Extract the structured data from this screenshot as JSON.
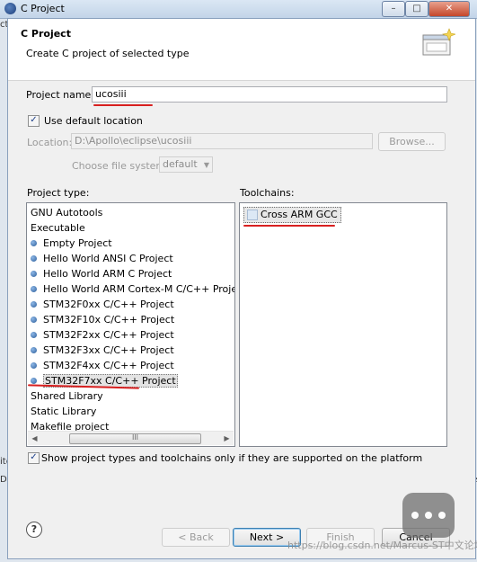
{
  "window": {
    "title": "C Project",
    "minimize": "–",
    "maximize": "□",
    "close": "✕"
  },
  "header": {
    "title": "C Project",
    "description": "Create C project of selected type"
  },
  "form": {
    "project_name_label": "Project name:",
    "project_name_value": "ucosiii",
    "use_default_location_label": "Use default location",
    "use_default_location_checked": true,
    "location_label": "Location:",
    "location_value": "D:\\Apollo\\eclipse\\ucosiii",
    "browse_label": "Browse...",
    "file_system_label": "Choose file system:",
    "file_system_value": "default"
  },
  "project_type": {
    "label": "Project type:",
    "items": [
      {
        "label": "GNU Autotools",
        "kind": "category"
      },
      {
        "label": "Executable",
        "kind": "category"
      },
      {
        "label": "Empty Project",
        "kind": "child"
      },
      {
        "label": "Hello World ANSI C Project",
        "kind": "child"
      },
      {
        "label": "Hello World ARM C Project",
        "kind": "child"
      },
      {
        "label": "Hello World ARM Cortex-M C/C++ Project",
        "kind": "child"
      },
      {
        "label": "STM32F0xx C/C++ Project",
        "kind": "child"
      },
      {
        "label": "STM32F10x C/C++ Project",
        "kind": "child"
      },
      {
        "label": "STM32F2xx C/C++ Project",
        "kind": "child"
      },
      {
        "label": "STM32F3xx C/C++ Project",
        "kind": "child"
      },
      {
        "label": "STM32F4xx C/C++ Project",
        "kind": "child"
      },
      {
        "label": "STM32F7xx C/C++ Project",
        "kind": "child",
        "selected": true
      },
      {
        "label": "Shared Library",
        "kind": "category"
      },
      {
        "label": "Static Library",
        "kind": "category"
      },
      {
        "label": "Makefile project",
        "kind": "category"
      }
    ],
    "scroll_thumb": "III"
  },
  "toolchains": {
    "label": "Toolchains:",
    "items": [
      "Cross ARM GCC"
    ]
  },
  "filter": {
    "label": "Show project types and toolchains only if they are supported on the platform",
    "checked": true
  },
  "footer": {
    "help": "?",
    "back": "< Back",
    "next": "Next >",
    "finish": "Finish",
    "cancel": "Cancel"
  },
  "background_fragments": {
    "left_top": "ct",
    "left_mid1": "ite",
    "left_mid2": "De",
    "right_mid": "pe"
  },
  "watermark": "https://blog.csdn.net/Marcus-ST中文论坛"
}
